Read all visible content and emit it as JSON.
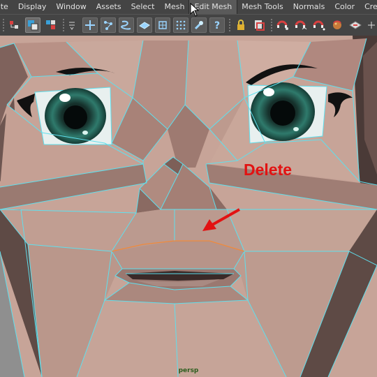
{
  "menubar": {
    "items": [
      "ate",
      "Display",
      "Window",
      "Assets",
      "Select",
      "Mesh",
      "Edit Mesh",
      "Mesh Tools",
      "Normals",
      "Color",
      "Create UVs"
    ],
    "active_item": "Edit Mesh"
  },
  "toolbar": {
    "icons": [
      "select-by-hierarchy-icon",
      "select-by-object-icon",
      "select-by-component-icon",
      "menu-toggle-icon",
      "vertex-mode-icon",
      "edge-mode-icon",
      "curve-mode-icon",
      "face-mode-icon",
      "uv-mode-icon",
      "multi-component-icon",
      "paint-select-icon",
      "help-icon",
      "lock-icon",
      "snap-to-icon",
      "magnet-snap-icon",
      "curve-snap-icon",
      "point-snap-icon",
      "live-surface-icon",
      "view-plane-icon",
      "extra-tool-icon"
    ]
  },
  "viewport": {
    "camera_label": "persp",
    "annotation_text": "Delete"
  },
  "colors": {
    "menu_bg": "#444444",
    "wire": "#5fe0ee",
    "skin": "#c9a69b",
    "selected_edge": "#f08a3c",
    "annotation": "#e21212",
    "camera_label": "#2c5e1e"
  }
}
